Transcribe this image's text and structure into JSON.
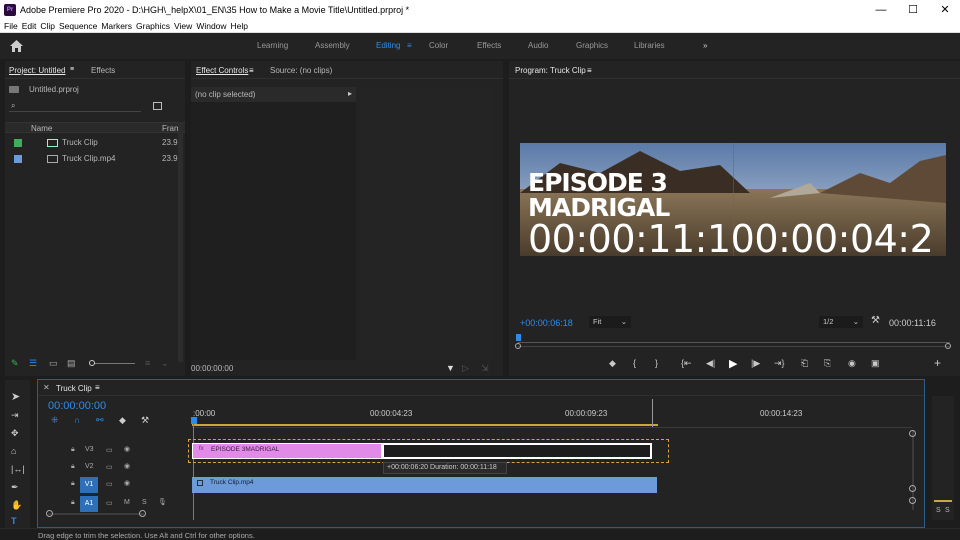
{
  "titlebar": {
    "app_badge": "Pr",
    "title": "Adobe Premiere Pro 2020 - D:\\HGH\\_helpX\\01_EN\\35 How to Make a Movie Title\\Untitled.prproj *",
    "minimize": "—",
    "maximize": "☐",
    "close": "✕"
  },
  "menu": [
    "File",
    "Edit",
    "Clip",
    "Sequence",
    "Markers",
    "Graphics",
    "View",
    "Window",
    "Help"
  ],
  "workspaces": {
    "items": [
      "Learning",
      "Assembly",
      "Editing",
      "Color",
      "Effects",
      "Audio",
      "Graphics",
      "Libraries"
    ],
    "active": "Editing",
    "more": "»"
  },
  "project": {
    "tab": "Project: Untitled",
    "tab2": "Effects",
    "file": "Untitled.prproj",
    "col_name": "Name",
    "col_frame": "Fram",
    "items": [
      {
        "name": "Truck Clip",
        "rate": "23.9",
        "color": "#3fae5a"
      },
      {
        "name": "Truck Clip.mp4",
        "rate": "23.9",
        "color": "#6d9ad8"
      }
    ]
  },
  "effect_controls": {
    "tab": "Effect Controls",
    "tab2": "Source: (no clips)",
    "no_clip": "(no clip selected)",
    "timecode": "00:00:00:00"
  },
  "program": {
    "tab": "Program: Truck Clip",
    "title_line1": "EPISODE 3",
    "title_line2": "MADRIGAL",
    "overlay_tc": "00:00:11:100:00:04:2",
    "current_tc": "+00:00:06:18",
    "fit": "Fit",
    "res": "1/2",
    "duration": "00:00:11:16"
  },
  "timeline": {
    "tab": "Truck Clip",
    "timecode": "00:00:00:00",
    "ruler": [
      ":00:00",
      "00:00:04:23",
      "00:00:09:23",
      "00:00:14:23"
    ],
    "tracks": [
      {
        "name": "V3",
        "label": "V3"
      },
      {
        "name": "V2",
        "label": "V2"
      },
      {
        "name": "V1",
        "label": "V1"
      },
      {
        "name": "A1",
        "label": "A1"
      }
    ],
    "title_clip": "EPISODE 3MADRIGAL",
    "video_clip": "Truck Clip.mp4",
    "tooltip": "+00:00:06:20 Duration: 00:00:11:18",
    "m": "M",
    "s": "S"
  },
  "status": "Drag edge to trim the selection. Use Alt and Ctrl for other options.",
  "meter": {
    "s1": "S",
    "s2": "S"
  },
  "colors": {
    "accent": "#2d8ceb",
    "title_clip": "#e28ae8",
    "video_clip": "#6d9ad8",
    "trim_border": "#d9a43c"
  }
}
